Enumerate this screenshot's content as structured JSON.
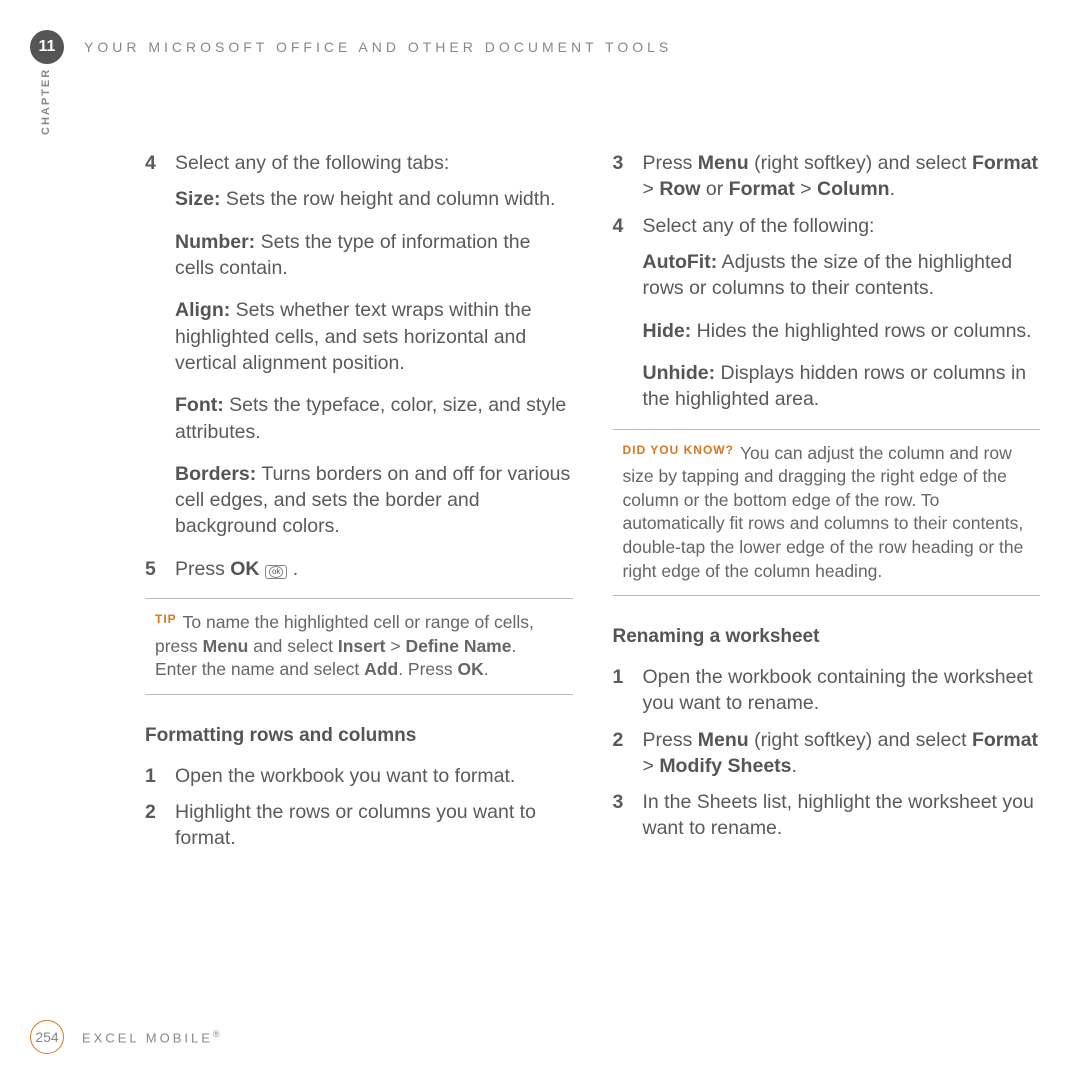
{
  "chapter": {
    "number": "11",
    "label": "CHAPTER"
  },
  "header": {
    "title": "YOUR MICROSOFT OFFICE AND OTHER DOCUMENT TOOLS"
  },
  "left": {
    "step4": {
      "num": "4",
      "intro": "Select any of the following tabs:",
      "size": {
        "label": "Size:",
        "text": " Sets the row height and column width."
      },
      "number": {
        "label": "Number:",
        "text": " Sets the type of information the cells contain."
      },
      "align": {
        "label": "Align:",
        "text": " Sets whether text wraps within the highlighted cells, and sets horizontal and vertical alignment position."
      },
      "font": {
        "label": "Font:",
        "text": " Sets the typeface, color, size, and style attributes."
      },
      "borders": {
        "label": "Borders:",
        "text": " Turns borders on and off for various cell edges, and sets the border and background colors."
      }
    },
    "step5": {
      "num": "5",
      "text_pre": "Press ",
      "ok": "OK",
      "ok_glyph": "ok",
      "period": " ."
    },
    "tip": {
      "tag": "TIP",
      "t1": "To name the highlighted cell or range of cells, press ",
      "menu": "Menu",
      "t2": " and select ",
      "insert": "Insert",
      "gt": " > ",
      "define": "Define Name",
      "t3": ". Enter the name and select ",
      "add": "Add",
      "t4": ". Press ",
      "ok": "OK",
      "t5": "."
    },
    "sec1": {
      "head": "Formatting rows and columns",
      "s1": {
        "num": "1",
        "text": "Open the workbook you want to format."
      },
      "s2": {
        "num": "2",
        "text": "Highlight the rows or columns you want to format."
      }
    }
  },
  "right": {
    "s3": {
      "num": "3",
      "pre": "Press ",
      "menu": "Menu",
      "paren": " (right softkey) and select ",
      "f1": "Format",
      "gt": " > ",
      "row": "Row",
      "or": " or ",
      "f2": "Format",
      "col": "Column",
      "dot": "."
    },
    "s4": {
      "num": "4",
      "intro": "Select any of the following:",
      "autofit": {
        "label": "AutoFit:",
        "text": " Adjusts the size of the highlighted rows or columns to their contents."
      },
      "hide": {
        "label": "Hide:",
        "text": " Hides the highlighted rows or columns."
      },
      "unhide": {
        "label": "Unhide:",
        "text": " Displays hidden rows or columns in the highlighted area."
      }
    },
    "dyk": {
      "tag": "DID YOU KNOW?",
      "text": "You can adjust the column and row size by tapping and dragging the right edge of the column or the bottom edge of the row. To automatically fit rows and columns to their contents, double-tap the lower edge of the row heading or the right edge of the column heading."
    },
    "sec2": {
      "head": "Renaming a worksheet",
      "s1": {
        "num": "1",
        "text": "Open the workbook containing the worksheet you want to rename."
      },
      "s2": {
        "num": "2",
        "pre": "Press ",
        "menu": "Menu",
        "paren": " (right softkey) and select ",
        "format": "Format",
        "gt": " > ",
        "modify": "Modify Sheets",
        "dot": "."
      },
      "s3": {
        "num": "3",
        "text": "In the Sheets list, highlight the worksheet you want to rename."
      }
    }
  },
  "footer": {
    "page": "254",
    "title": "EXCEL MOBILE",
    "reg": "®"
  }
}
